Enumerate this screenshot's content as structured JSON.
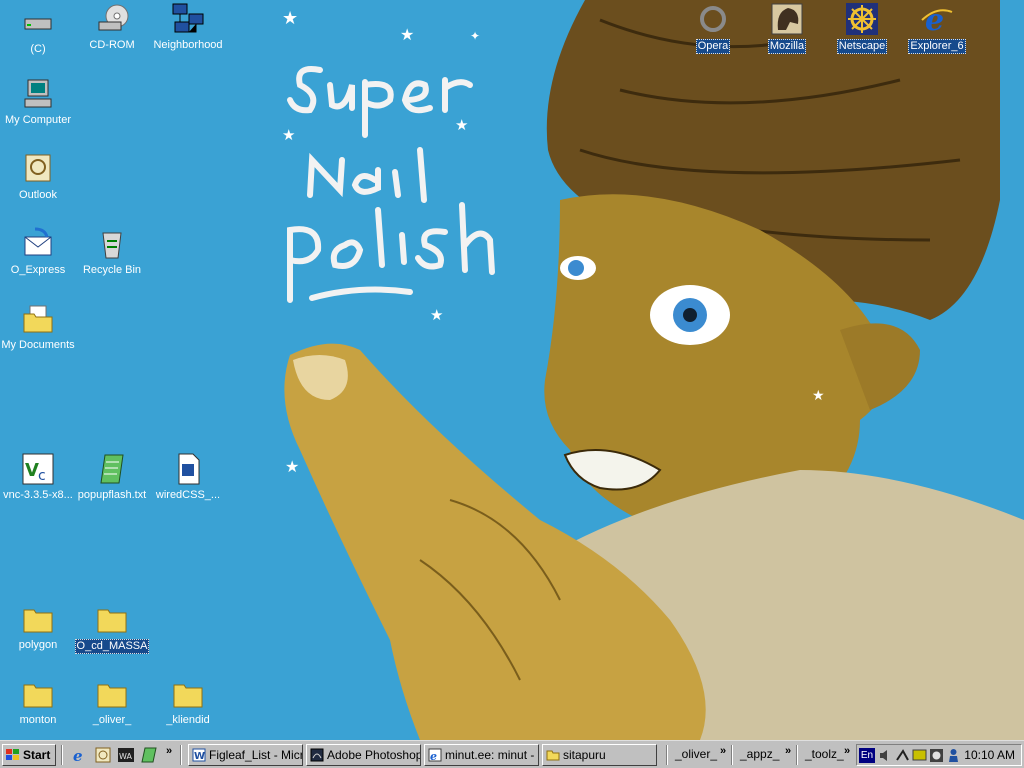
{
  "desktop": {
    "icons_left": [
      {
        "label": "(C)",
        "icon": "drive-icon"
      },
      {
        "label": "CD-ROM",
        "icon": "cdrom-icon"
      },
      {
        "label": "Neighborhood",
        "icon": "network-icon"
      },
      {
        "label": "My Computer",
        "icon": "computer-icon"
      },
      {
        "label": "Outlook",
        "icon": "outlook-icon"
      },
      {
        "label": "O_Express",
        "icon": "outlook-express-icon"
      },
      {
        "label": "Recycle Bin",
        "icon": "recycle-bin-icon"
      },
      {
        "label": "My Documents",
        "icon": "folder-icon"
      },
      {
        "label": "vnc-3.3.5-x8...",
        "icon": "vnc-icon"
      },
      {
        "label": "popupflash.txt",
        "icon": "text-file-icon"
      },
      {
        "label": "wiredCSS_...",
        "icon": "document-icon"
      },
      {
        "label": "polygon",
        "icon": "folder-icon"
      },
      {
        "label": "O_cd_MASSA",
        "icon": "folder-icon"
      },
      {
        "label": "monton",
        "icon": "folder-icon"
      },
      {
        "label": "_oliver_",
        "icon": "folder-icon"
      },
      {
        "label": "_kliendid",
        "icon": "folder-icon"
      }
    ],
    "icons_top": [
      {
        "label": "Opera",
        "icon": "opera-icon"
      },
      {
        "label": "Mozilla",
        "icon": "mozilla-icon"
      },
      {
        "label": "Netscape",
        "icon": "netscape-icon"
      },
      {
        "label": "Explorer_6",
        "icon": "internet-explorer-icon"
      }
    ],
    "wallpaper_text": [
      "Super",
      "Nail",
      "polish"
    ]
  },
  "taskbar": {
    "start_label": "Start",
    "tasks": [
      {
        "label": "Figleaf_List - Micr...",
        "icon": "word-icon"
      },
      {
        "label": "Adobe Photoshop",
        "icon": "photoshop-icon"
      },
      {
        "label": "minut.ee: minut - ...",
        "icon": "ie-window-icon"
      },
      {
        "label": "sitapuru",
        "icon": "folder-icon"
      }
    ],
    "toolbars": [
      "_oliver_",
      "_appz_",
      "_toolz_"
    ],
    "clock": "10:10 AM",
    "language": "En"
  },
  "colors": {
    "desktop": "#3aa2d4",
    "taskbar": "#c0c0c0",
    "selection": "#164a8c"
  }
}
